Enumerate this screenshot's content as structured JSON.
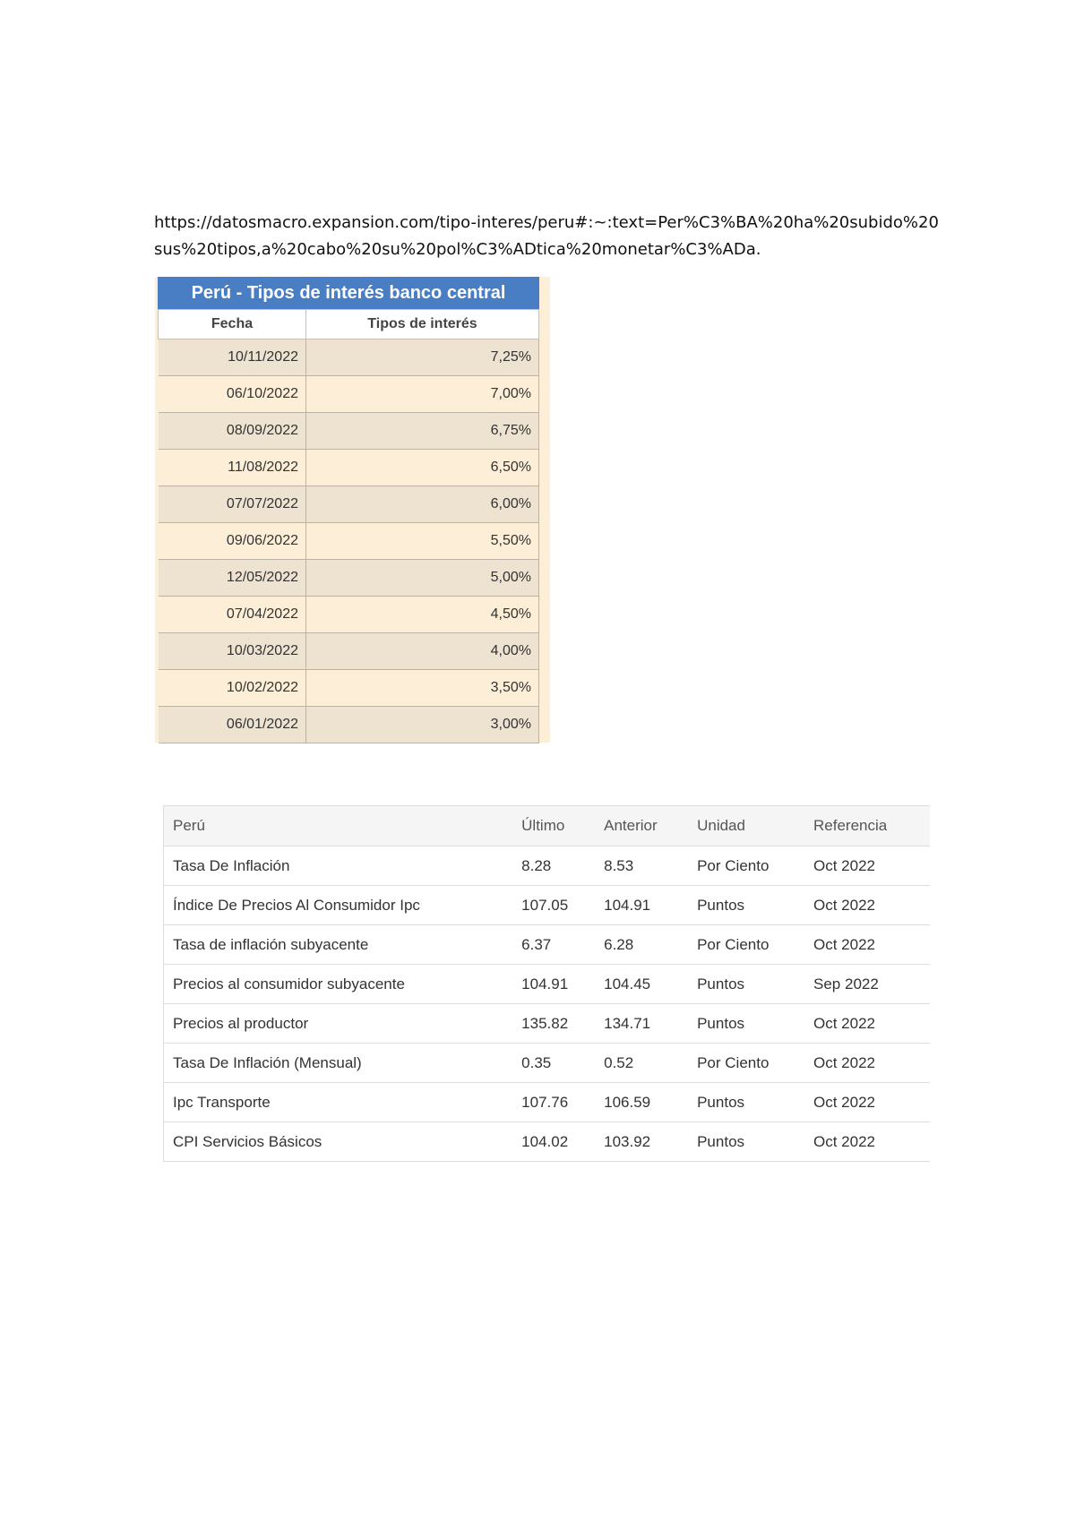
{
  "source_url": "https://datosmacro.expansion.com/tipo-interes/peru#:~:text=Per%C3%BA%20ha%20subido%20sus%20tipos,a%20cabo%20su%20pol%C3%ADtica%20monetar%C3%ADa.",
  "interest_table": {
    "title": "Perú - Tipos de interés banco central",
    "headers": [
      "Fecha",
      "Tipos de interés"
    ],
    "rows": [
      {
        "date": "10/11/2022",
        "rate": "7,25%"
      },
      {
        "date": "06/10/2022",
        "rate": "7,00%"
      },
      {
        "date": "08/09/2022",
        "rate": "6,75%"
      },
      {
        "date": "11/08/2022",
        "rate": "6,50%"
      },
      {
        "date": "07/07/2022",
        "rate": "6,00%"
      },
      {
        "date": "09/06/2022",
        "rate": "5,50%"
      },
      {
        "date": "12/05/2022",
        "rate": "5,00%"
      },
      {
        "date": "07/04/2022",
        "rate": "4,50%"
      },
      {
        "date": "10/03/2022",
        "rate": "4,00%"
      },
      {
        "date": "10/02/2022",
        "rate": "3,50%"
      },
      {
        "date": "06/01/2022",
        "rate": "3,00%"
      }
    ]
  },
  "inflation_table": {
    "headers": [
      "Perú",
      "Último",
      "Anterior",
      "Unidad",
      "Referencia"
    ],
    "rows": [
      {
        "name": "Tasa De Inflación",
        "last": "8.28",
        "previous": "8.53",
        "unit": "Por Ciento",
        "reference": "Oct 2022"
      },
      {
        "name": "Índice De Precios Al Consumidor Ipc",
        "last": "107.05",
        "previous": "104.91",
        "unit": "Puntos",
        "reference": "Oct 2022"
      },
      {
        "name": "Tasa de inflación subyacente",
        "last": "6.37",
        "previous": "6.28",
        "unit": "Por Ciento",
        "reference": "Oct 2022"
      },
      {
        "name": "Precios al consumidor subyacente",
        "last": "104.91",
        "previous": "104.45",
        "unit": "Puntos",
        "reference": "Sep 2022"
      },
      {
        "name": "Precios al productor",
        "last": "135.82",
        "previous": "134.71",
        "unit": "Puntos",
        "reference": "Oct 2022"
      },
      {
        "name": "Tasa De Inflación (Mensual)",
        "last": "0.35",
        "previous": "0.52",
        "unit": "Por Ciento",
        "reference": "Oct 2022"
      },
      {
        "name": "Ipc Transporte",
        "last": "107.76",
        "previous": "106.59",
        "unit": "Puntos",
        "reference": "Oct 2022"
      },
      {
        "name": "CPI Servicios Básicos",
        "last": "104.02",
        "previous": "103.92",
        "unit": "Puntos",
        "reference": "Oct 2022"
      }
    ]
  }
}
